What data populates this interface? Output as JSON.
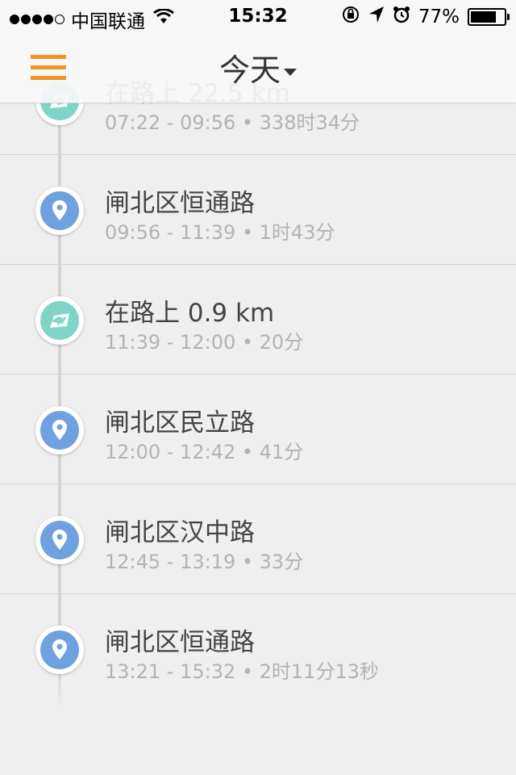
{
  "status_bar": {
    "carrier": "中国联通",
    "time": "15:32",
    "battery": "77%",
    "battery_level": 0.77
  },
  "nav": {
    "title": "今天"
  },
  "timeline": [
    {
      "kind": "move",
      "title": "在路上 22.5 km",
      "time_range": "07:22 - 09:56",
      "sep": " • ",
      "duration": "338时34分"
    },
    {
      "kind": "place",
      "title": "闸北区恒通路",
      "time_range": "09:56 - 11:39",
      "sep": " • ",
      "duration": "1时43分"
    },
    {
      "kind": "move",
      "title": "在路上 0.9 km",
      "time_range": "11:39 - 12:00",
      "sep": " • ",
      "duration": "20分"
    },
    {
      "kind": "place",
      "title": "闸北区民立路",
      "time_range": "12:00 - 12:42",
      "sep": " • ",
      "duration": "41分"
    },
    {
      "kind": "place",
      "title": "闸北区汉中路",
      "time_range": "12:45 - 13:19",
      "sep": " • ",
      "duration": "33分"
    },
    {
      "kind": "place",
      "title": "闸北区恒通路",
      "time_range": "13:21 - 15:32",
      "sep": " • ",
      "duration": "2时11分13秒"
    }
  ],
  "colors": {
    "accent": "#f39325",
    "place_marker": "#6fa1de",
    "move_marker": "#7fd4c6",
    "subtitle_text": "#b3b3b3"
  },
  "icons": {
    "menu": "hamburger-icon",
    "place": "map-pin-icon",
    "move": "road-icon",
    "signal": "signal-dots-icon",
    "wifi": "wifi-icon",
    "rotation_lock": "rotation-lock-icon",
    "location": "location-arrow-icon",
    "alarm": "alarm-icon",
    "battery": "battery-icon"
  }
}
